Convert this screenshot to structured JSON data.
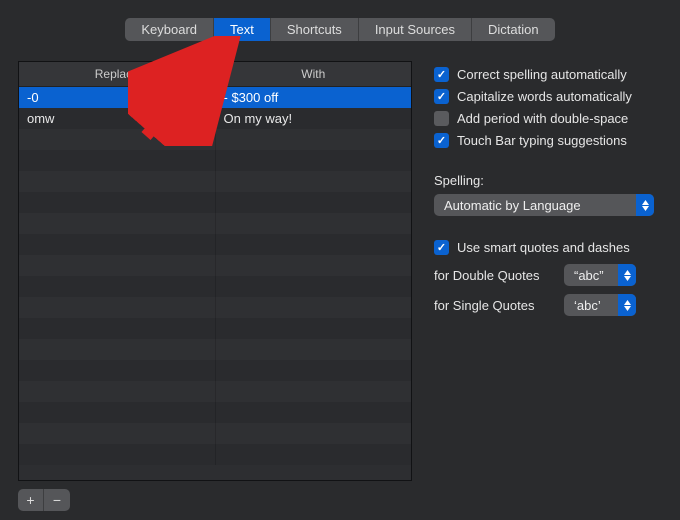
{
  "tabs": [
    {
      "label": "Keyboard",
      "active": false
    },
    {
      "label": "Text",
      "active": true
    },
    {
      "label": "Shortcuts",
      "active": false
    },
    {
      "label": "Input Sources",
      "active": false
    },
    {
      "label": "Dictation",
      "active": false
    }
  ],
  "table": {
    "columns": {
      "replace": "Replace",
      "with": "With"
    },
    "rows": [
      {
        "replace": "-0",
        "with": "- $300 off",
        "selected": true
      },
      {
        "replace": "omw",
        "with": "On my way!",
        "selected": false
      }
    ],
    "blank_rows": 16
  },
  "buttons": {
    "add": "+",
    "remove": "−"
  },
  "options": {
    "correct_spelling": {
      "label": "Correct spelling automatically",
      "checked": true
    },
    "capitalize": {
      "label": "Capitalize words automatically",
      "checked": true
    },
    "add_period": {
      "label": "Add period with double-space",
      "checked": false
    },
    "touch_bar": {
      "label": "Touch Bar typing suggestions",
      "checked": true
    },
    "spelling_label": "Spelling:",
    "spelling_value": "Automatic by Language",
    "smart_quotes": {
      "label": "Use smart quotes and dashes",
      "checked": true
    },
    "double_quotes_label": "for Double Quotes",
    "double_quotes_value": "“abc”",
    "single_quotes_label": "for Single Quotes",
    "single_quotes_value": "‘abc’"
  }
}
